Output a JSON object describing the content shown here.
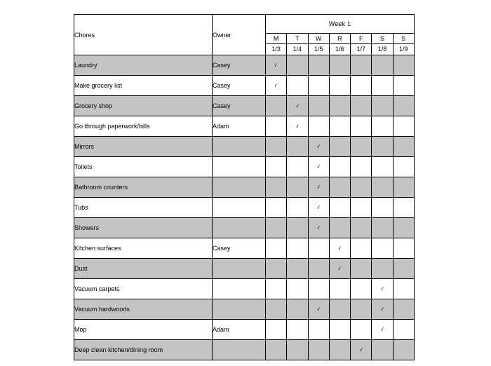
{
  "table": {
    "headers": {
      "chores": "Chores",
      "owner": "Owner",
      "week_group": "Week 1",
      "days": [
        "M",
        "T",
        "W",
        "R",
        "F",
        "S",
        "S"
      ],
      "dates": [
        "1/3",
        "1/4",
        "1/5",
        "1/6",
        "1/7",
        "1/8",
        "1/9"
      ]
    },
    "mark_glyph": "✓",
    "shade_color": "#c4c4c4",
    "rows": [
      {
        "chore": "Laundry",
        "owner": "Casey",
        "marks": [
          true,
          false,
          false,
          false,
          false,
          false,
          false
        ]
      },
      {
        "chore": "Make grocery list",
        "owner": "Casey",
        "marks": [
          true,
          false,
          false,
          false,
          false,
          false,
          false
        ]
      },
      {
        "chore": "Grocery shop",
        "owner": "Casey",
        "marks": [
          false,
          true,
          false,
          false,
          false,
          false,
          false
        ]
      },
      {
        "chore": "Go through paperwork/bills",
        "owner": "Adam",
        "marks": [
          false,
          true,
          false,
          false,
          false,
          false,
          false
        ]
      },
      {
        "chore": "Mirrors",
        "owner": "",
        "marks": [
          false,
          false,
          true,
          false,
          false,
          false,
          false
        ]
      },
      {
        "chore": "Toilets",
        "owner": "",
        "marks": [
          false,
          false,
          true,
          false,
          false,
          false,
          false
        ]
      },
      {
        "chore": "Bathroom counters",
        "owner": "",
        "marks": [
          false,
          false,
          true,
          false,
          false,
          false,
          false
        ]
      },
      {
        "chore": "Tubs",
        "owner": "",
        "marks": [
          false,
          false,
          true,
          false,
          false,
          false,
          false
        ]
      },
      {
        "chore": "Showers",
        "owner": "",
        "marks": [
          false,
          false,
          true,
          false,
          false,
          false,
          false
        ]
      },
      {
        "chore": "Kitchen surfaces",
        "owner": "Casey",
        "marks": [
          false,
          false,
          false,
          true,
          false,
          false,
          false
        ]
      },
      {
        "chore": "Dust",
        "owner": "",
        "marks": [
          false,
          false,
          false,
          true,
          false,
          false,
          false
        ]
      },
      {
        "chore": "Vacuum carpets",
        "owner": "",
        "marks": [
          false,
          false,
          false,
          false,
          false,
          true,
          false
        ]
      },
      {
        "chore": "Vacuum hardwoods",
        "owner": "",
        "marks": [
          false,
          false,
          true,
          false,
          false,
          true,
          false
        ]
      },
      {
        "chore": "Mop",
        "owner": "Adam",
        "marks": [
          false,
          false,
          false,
          false,
          false,
          true,
          false
        ]
      },
      {
        "chore": "Deep clean kitchen/dining room",
        "owner": "",
        "marks": [
          false,
          false,
          false,
          false,
          true,
          false,
          false
        ]
      }
    ]
  }
}
